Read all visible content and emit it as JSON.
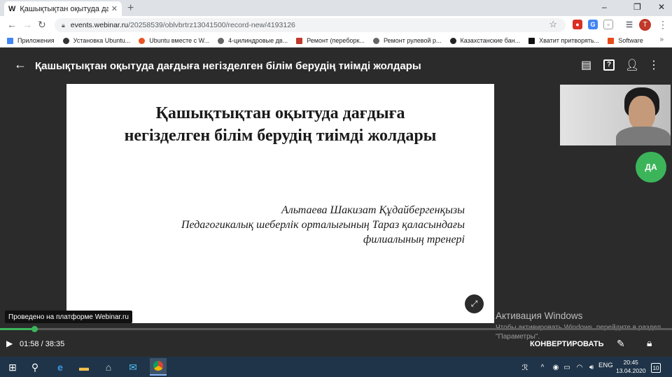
{
  "browser": {
    "tab_favicon": "W",
    "tab_title": "Қашықтықтан оқытуда дағдыға",
    "tab_close": "✕",
    "new_tab": "+",
    "window_controls": [
      "–",
      "❐",
      "✕"
    ],
    "url_host": "events.webinar.ru",
    "url_path": "/20258539/oblvbrtrz13041500/record-new/4193126",
    "profile_initial": "T",
    "bookmarks": [
      {
        "label": "Приложения",
        "icon_color": "#4285f4"
      },
      {
        "label": "Установка Ubuntu...",
        "icon_color": "#333333"
      },
      {
        "label": "Ubuntu вместе с W...",
        "icon_color": "#e95420"
      },
      {
        "label": "4-цилиндровые дв...",
        "icon_color": "#666666"
      },
      {
        "label": "Ремонт (переборк...",
        "icon_color": "#c0392b"
      },
      {
        "label": "Ремонт рулевой р...",
        "icon_color": "#666666"
      },
      {
        "label": "Казахстанские бан...",
        "icon_color": "#222222"
      },
      {
        "label": "Хватит притворять...",
        "icon_color": "#111111"
      },
      {
        "label": "Software",
        "icon_color": "#e64a19"
      }
    ],
    "bookmarks_more": "»"
  },
  "webinar": {
    "title": "Қашықтықтан оқытуда дағдыға негізделген білім берудің тиімді жолдары",
    "slide": {
      "title_line1": "Қашықтықтан оқытуда дағдыға",
      "title_line2": "негізделген білім берудің тиімді жолдары",
      "author_line1": "Альтаева Шакизат Құдайбергенқызы",
      "author_line2": "Педагогикалық шеберлік орталығының Тараз қаласындағы",
      "author_line3": "филиалының тренері"
    },
    "participant_badge": "ДА",
    "platform_label": "Проведено на платформе Webinar.ru",
    "player": {
      "current_time": "01:58",
      "total_time": "38:35",
      "progress": 0.051,
      "convert_label": "КОНВЕРТИРОВАТЬ"
    }
  },
  "windows": {
    "watermark_title": "Активация Windows",
    "watermark_text": "Чтобы активировать Windows, перейдите в раздел \"Параметры\".",
    "language": "ENG",
    "time": "20:45",
    "date": "13.04.2020",
    "notification_count": "10"
  },
  "colors": {
    "accent_green": "#3cb55a",
    "dark_bg": "#2b2b2b",
    "taskbar": "#1f3448"
  }
}
